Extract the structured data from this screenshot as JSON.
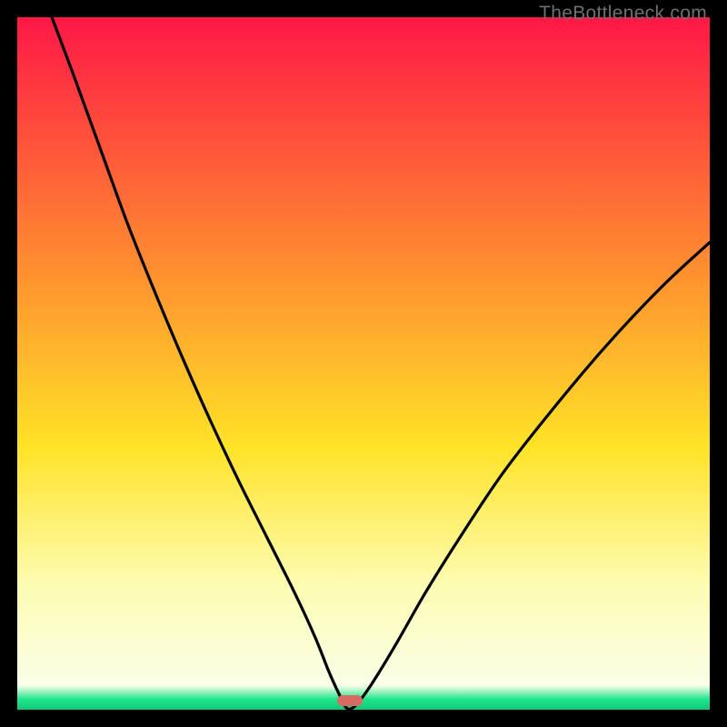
{
  "watermark": {
    "text": "TheBottleneck.com"
  },
  "colors": {
    "top": "#ff1846",
    "mid_upper": "#ff8a30",
    "mid": "#ffe327",
    "mid_lower": "#fdfcb2",
    "bottom": "#1fe58b",
    "marker": "#d86a64",
    "curve": "#000000"
  },
  "chart_data": {
    "type": "line",
    "title": "",
    "xlabel": "",
    "ylabel": "",
    "xlim": [
      0,
      100
    ],
    "ylim": [
      0,
      100
    ],
    "notes": "Vertical gradient from red (top) through orange, yellow, pale yellow to green (bottom). A black curve descends from top-left, reaches a minimum near x≈47 at y≈0, then rises to the right. A small rounded red marker sits at the curve minimum near the bottom.",
    "gradient_stops": [
      {
        "pos": 0.0,
        "color": "#ff1846"
      },
      {
        "pos": 0.35,
        "color": "#ff8a30"
      },
      {
        "pos": 0.62,
        "color": "#ffe327"
      },
      {
        "pos": 0.82,
        "color": "#fdfcb2"
      },
      {
        "pos": 0.965,
        "color": "#faffe7"
      },
      {
        "pos": 0.985,
        "color": "#1fe58b"
      },
      {
        "pos": 1.0,
        "color": "#10c777"
      }
    ],
    "series": [
      {
        "name": "left-branch",
        "x": [
          5.0,
          8.0,
          12.0,
          16.0,
          20.0,
          24.0,
          28.0,
          32.0,
          36.0,
          40.0,
          43.0,
          45.0,
          46.5,
          47.5
        ],
        "y": [
          100.0,
          92.0,
          81.0,
          70.0,
          60.0,
          50.5,
          41.5,
          33.0,
          25.0,
          17.0,
          10.5,
          5.5,
          2.2,
          0.3
        ]
      },
      {
        "name": "right-branch",
        "x": [
          48.5,
          50.0,
          52.0,
          55.0,
          59.0,
          64.0,
          70.0,
          77.0,
          85.0,
          93.0,
          100.0
        ],
        "y": [
          0.3,
          2.0,
          5.0,
          10.0,
          17.0,
          25.0,
          34.0,
          43.0,
          52.5,
          61.0,
          67.5
        ]
      }
    ],
    "marker": {
      "x": 48.0,
      "y": 1.3
    }
  }
}
